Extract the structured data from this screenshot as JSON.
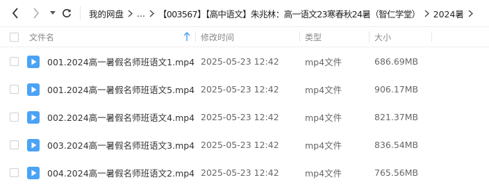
{
  "breadcrumb": {
    "root": "我的网盘",
    "ellipsis": "...",
    "folder1": "【003567】【高中语文】朱兆林：高一语文23寒春秋24暑（智仁学堂）",
    "folder2": "2024暑"
  },
  "table": {
    "headers": {
      "name": "文件名",
      "time": "修改时间",
      "type": "类型",
      "size": "大小"
    },
    "rows": [
      {
        "name": "001.2024高一暑假名师班语文1.mp4",
        "time": "2025-05-23 12:42",
        "type": "mp4文件",
        "size": "686.69MB"
      },
      {
        "name": "001.2024高一暑假名师班语文5.mp4",
        "time": "2025-05-23 12:42",
        "type": "mp4文件",
        "size": "906.17MB"
      },
      {
        "name": "002.2024高一暑假名师班语文4.mp4",
        "time": "2025-05-23 12:42",
        "type": "mp4文件",
        "size": "821.37MB"
      },
      {
        "name": "003.2024高一暑假名师班语文3.mp4",
        "time": "2025-05-23 12:42",
        "type": "mp4文件",
        "size": "836.54MB"
      },
      {
        "name": "004.2024高一暑假名师班语文2.mp4",
        "time": "2025-05-23 12:42",
        "type": "mp4文件",
        "size": "765.56MB"
      }
    ]
  },
  "colors": {
    "video_icon": "#4aa3f5",
    "sort_arrow": "#4aa3f5"
  },
  "icons": {
    "file": "video-file-icon",
    "sort": "sort-up-arrow-icon"
  }
}
